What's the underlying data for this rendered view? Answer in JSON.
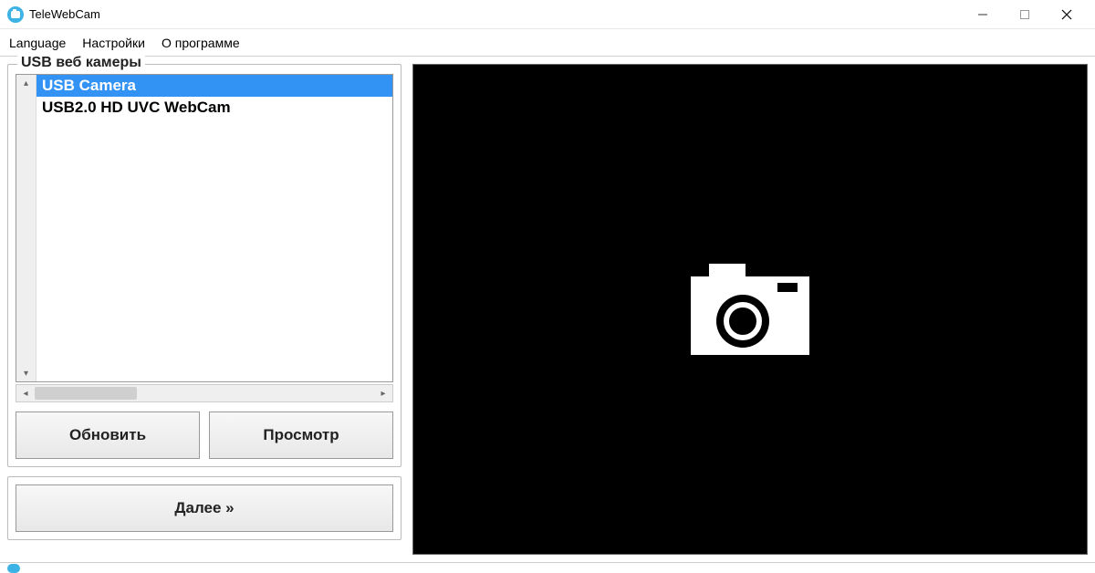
{
  "window": {
    "title": "TeleWebCam"
  },
  "menu": {
    "language": "Language",
    "settings": "Настройки",
    "about": "О программе"
  },
  "panel": {
    "groupbox_title": "USB веб камеры"
  },
  "cameras": [
    {
      "name": "USB Camera",
      "selected": true
    },
    {
      "name": "USB2.0 HD UVC WebCam",
      "selected": false
    }
  ],
  "buttons": {
    "refresh": "Обновить",
    "preview": "Просмотр",
    "next": "Далее »"
  }
}
